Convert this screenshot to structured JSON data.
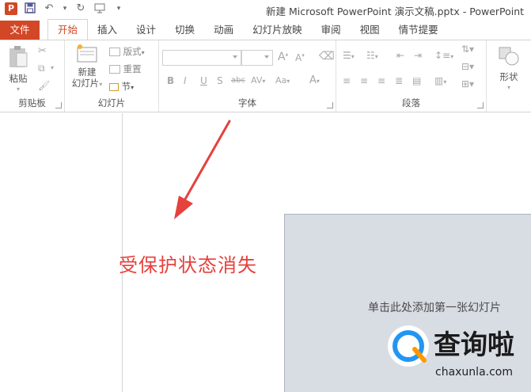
{
  "window": {
    "title": "新建 Microsoft PowerPoint 演示文稿.pptx - PowerPoint"
  },
  "qat": {
    "app_icon_letter": "P",
    "undo_dropdown": "▾",
    "customize": "▾"
  },
  "tabs": [
    {
      "label": "文件"
    },
    {
      "label": "开始"
    },
    {
      "label": "插入"
    },
    {
      "label": "设计"
    },
    {
      "label": "切换"
    },
    {
      "label": "动画"
    },
    {
      "label": "幻灯片放映"
    },
    {
      "label": "审阅"
    },
    {
      "label": "视图"
    },
    {
      "label": "情节提要"
    }
  ],
  "ribbon": {
    "clipboard": {
      "paste_label": "粘贴",
      "group_label": "剪贴板"
    },
    "slides": {
      "new_slide_line1": "新建",
      "new_slide_line2": "幻灯片",
      "layout_label": "版式",
      "reset_label": "重置",
      "section_label": "节",
      "group_label": "幻灯片"
    },
    "font": {
      "font_name_value": "",
      "font_size_value": "",
      "grow_font": "A",
      "shrink_font": "A",
      "bold": "B",
      "italic": "I",
      "underline": "U",
      "shadow": "S",
      "strikethrough": "abc",
      "char_spacing": "AV",
      "change_case": "Aa",
      "font_color": "A",
      "group_label": "字体"
    },
    "paragraph": {
      "group_label": "段落"
    },
    "drawing": {
      "shapes_label": "形状"
    }
  },
  "slide": {
    "placeholder_text": "单击此处添加第一张幻灯片"
  },
  "annotation": {
    "text": "受保护状态消失",
    "color": "#e5413d"
  },
  "watermark": {
    "brand_cn": "查询啦",
    "brand_en": "chaxunla.com"
  },
  "colors": {
    "accent": "#d24726",
    "slide_bg": "#d8dde4"
  }
}
